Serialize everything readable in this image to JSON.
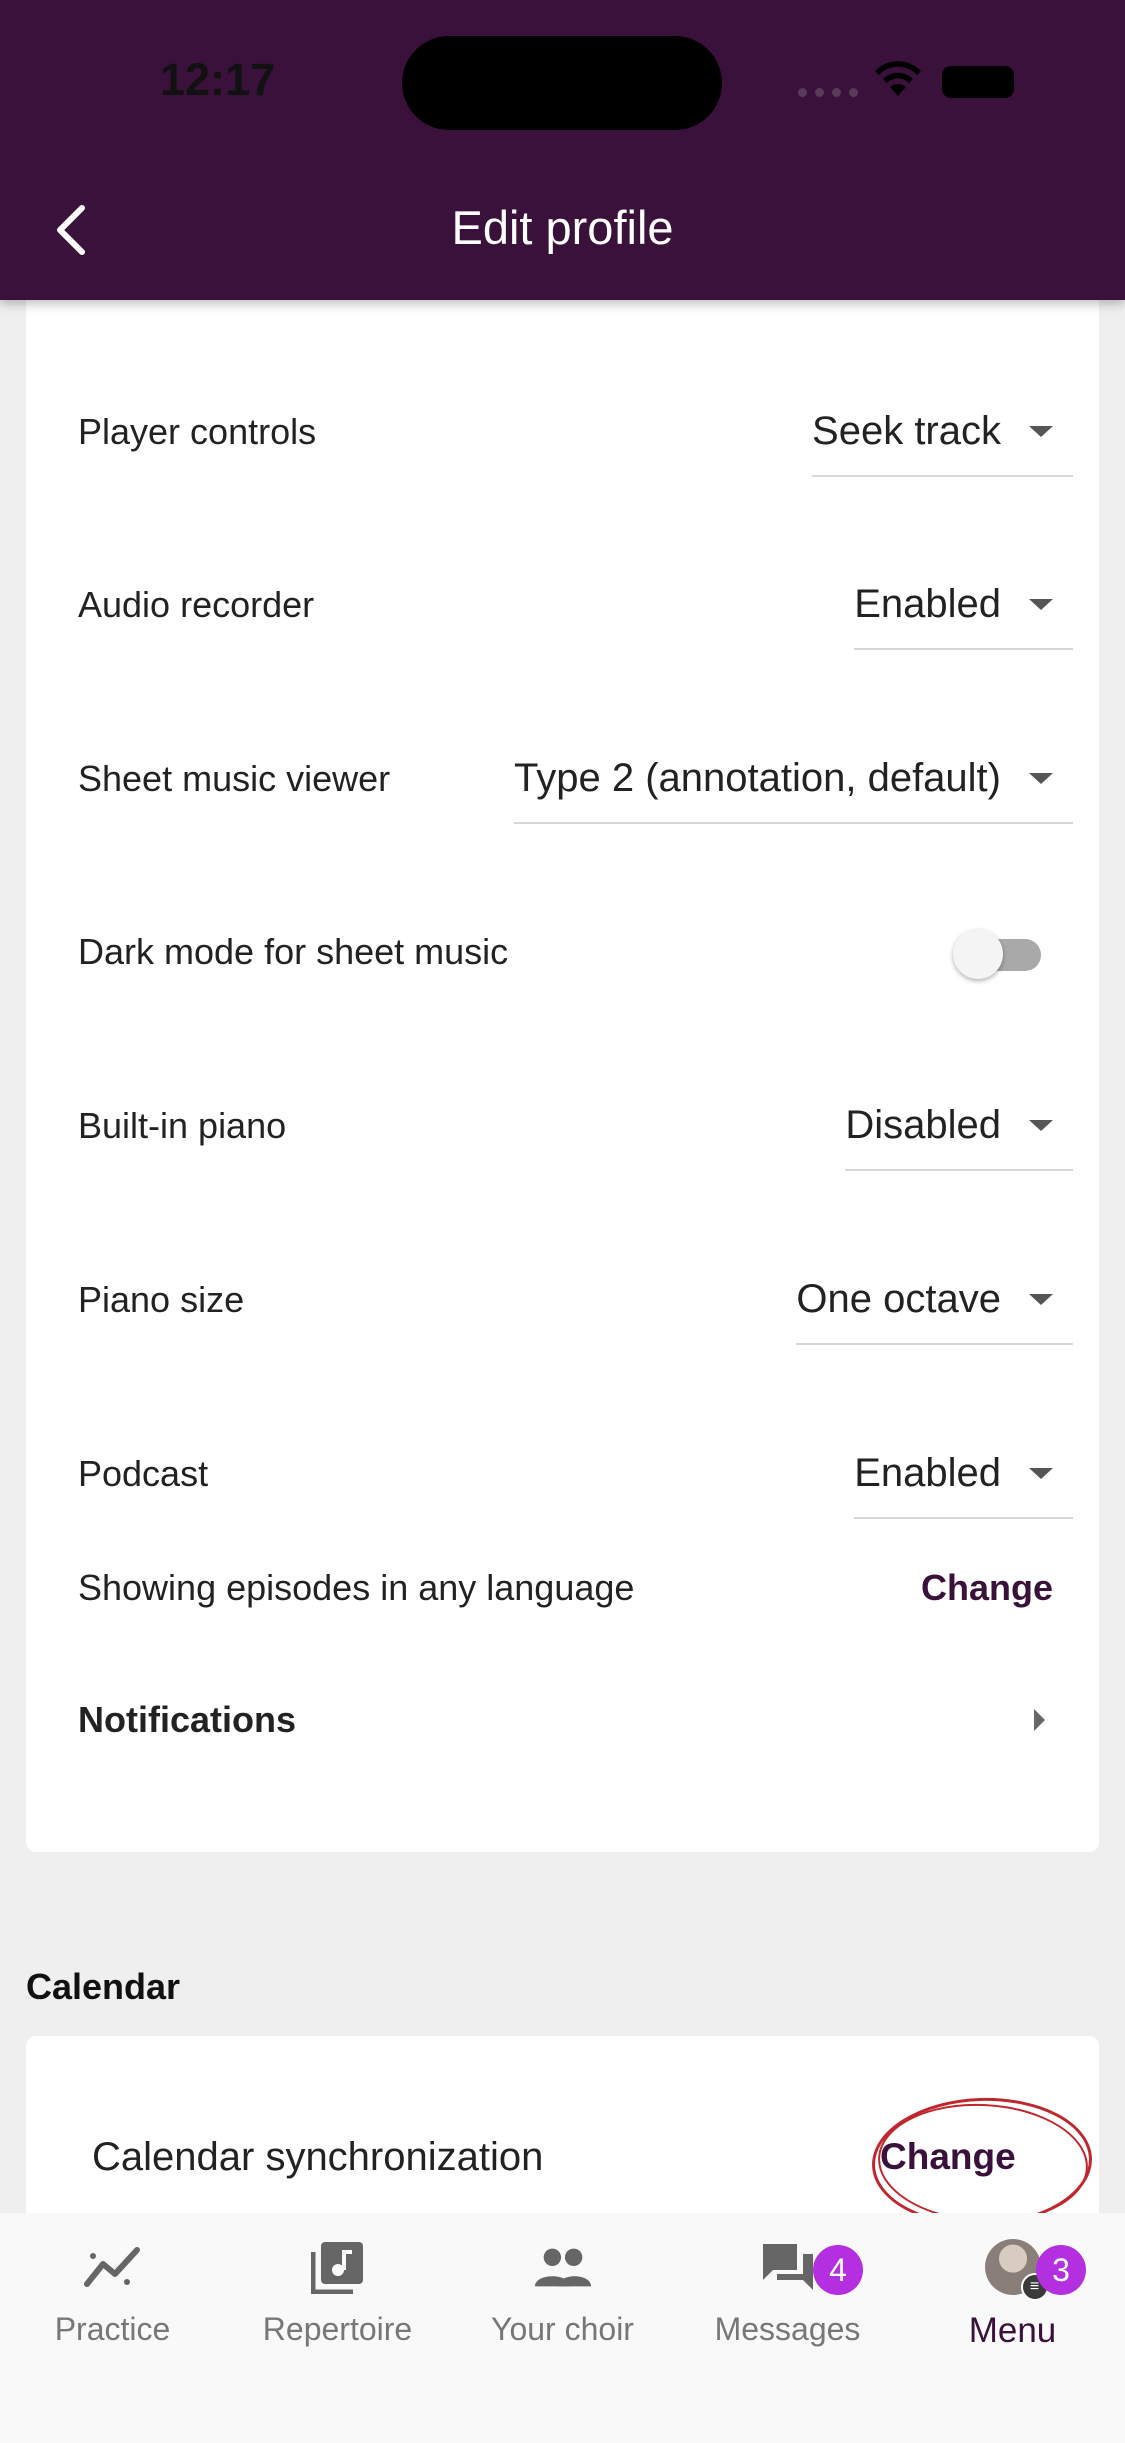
{
  "status_bar": {
    "time": "12:17"
  },
  "header": {
    "title": "Edit profile",
    "back_icon": "chevron-left-icon"
  },
  "settings": {
    "player_controls": {
      "label": "Player controls",
      "value": "Seek track"
    },
    "audio_recorder": {
      "label": "Audio recorder",
      "value": "Enabled"
    },
    "sheet_music_viewer": {
      "label": "Sheet music viewer",
      "value": "Type 2 (annotation, default)"
    },
    "dark_mode": {
      "label": "Dark mode for sheet music",
      "on": false
    },
    "builtin_piano": {
      "label": "Built-in piano",
      "value": "Disabled"
    },
    "piano_size": {
      "label": "Piano size",
      "value": "One octave"
    },
    "podcast": {
      "label": "Podcast",
      "value": "Enabled"
    },
    "episodes": {
      "label": "Showing episodes in any language",
      "action": "Change"
    },
    "notifications": {
      "label": "Notifications"
    }
  },
  "calendar": {
    "section_title": "Calendar",
    "sync_label": "Calendar synchronization",
    "sync_action": "Change"
  },
  "tabbar": {
    "tabs": [
      {
        "label": "Practice",
        "icon": "practice-icon"
      },
      {
        "label": "Repertoire",
        "icon": "music-library-icon"
      },
      {
        "label": "Your choir",
        "icon": "people-icon"
      },
      {
        "label": "Messages",
        "icon": "chat-icon",
        "badge": "4"
      },
      {
        "label": "Menu",
        "icon": "avatar",
        "badge": "3",
        "active": true
      }
    ]
  },
  "colors": {
    "primary": "#3a113b",
    "badge": "#b32fe0",
    "annotation": "#c0262d"
  }
}
